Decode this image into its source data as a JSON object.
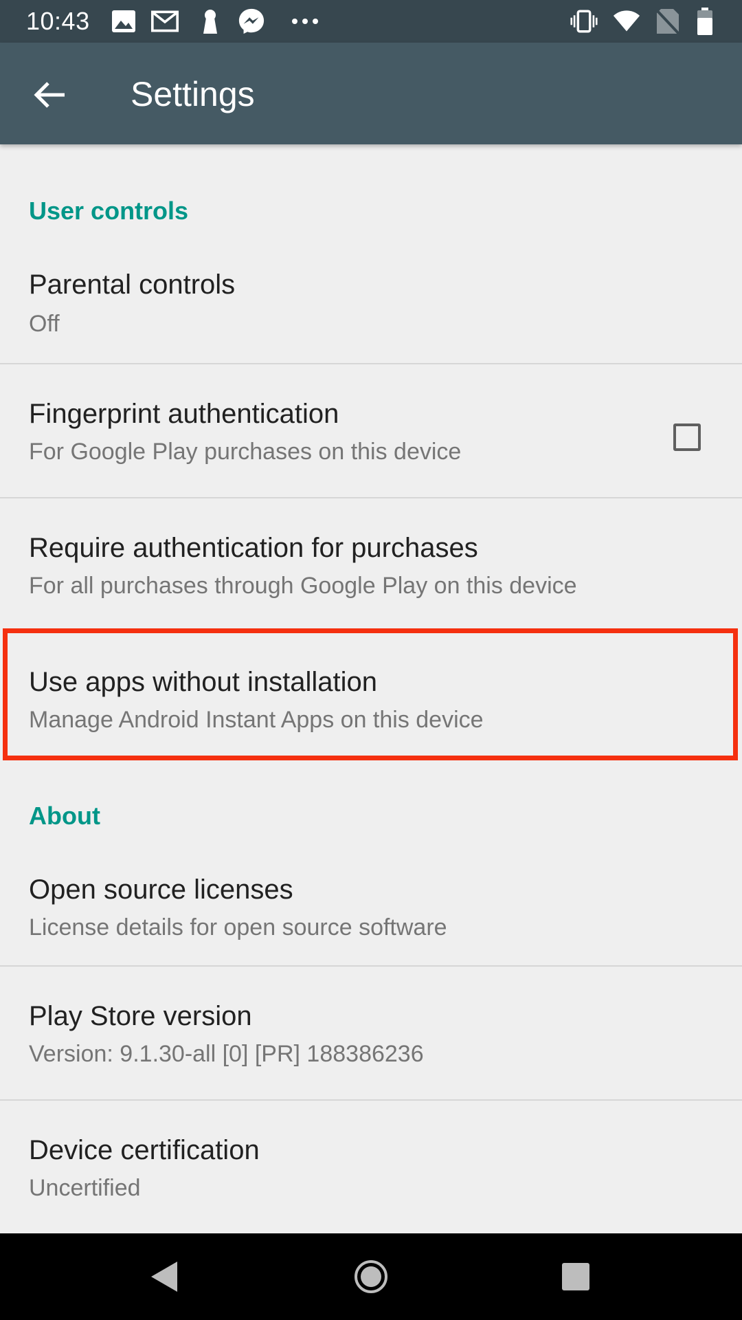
{
  "status_bar": {
    "time": "10:43",
    "left_icons": [
      "image-icon",
      "gmail-icon",
      "keyhole-icon",
      "messenger-icon",
      "more-dots-icon"
    ],
    "right_icons": [
      "vibrate-icon",
      "wifi-icon",
      "no-sim-icon",
      "battery-icon"
    ]
  },
  "toolbar": {
    "title": "Settings",
    "back_icon": "arrow-back-icon"
  },
  "sections": {
    "user_controls": {
      "header": "User controls",
      "items": [
        {
          "primary": "Parental controls",
          "secondary": "Off"
        },
        {
          "primary": "Fingerprint authentication",
          "secondary": "For Google Play purchases on this device",
          "checked": false
        },
        {
          "primary": "Require authentication for purchases",
          "secondary": "For all purchases through Google Play on this device"
        },
        {
          "primary": "Use apps without installation",
          "secondary": "Manage Android Instant Apps on this device"
        }
      ]
    },
    "about": {
      "header": "About",
      "items": [
        {
          "primary": "Open source licenses",
          "secondary": "License details for open source software"
        },
        {
          "primary": "Play Store version",
          "secondary": "Version: 9.1.30-all [0] [PR] 188386236"
        },
        {
          "primary": "Device certification",
          "secondary": "Uncertified"
        }
      ]
    }
  },
  "colors": {
    "status_bar": "#37474f",
    "toolbar": "#455a64",
    "section_header": "#009688",
    "highlight": "#f5300f",
    "background": "#efefef"
  },
  "nav_bar": {
    "icons": [
      "nav-back-icon",
      "nav-home-icon",
      "nav-recents-icon"
    ]
  }
}
